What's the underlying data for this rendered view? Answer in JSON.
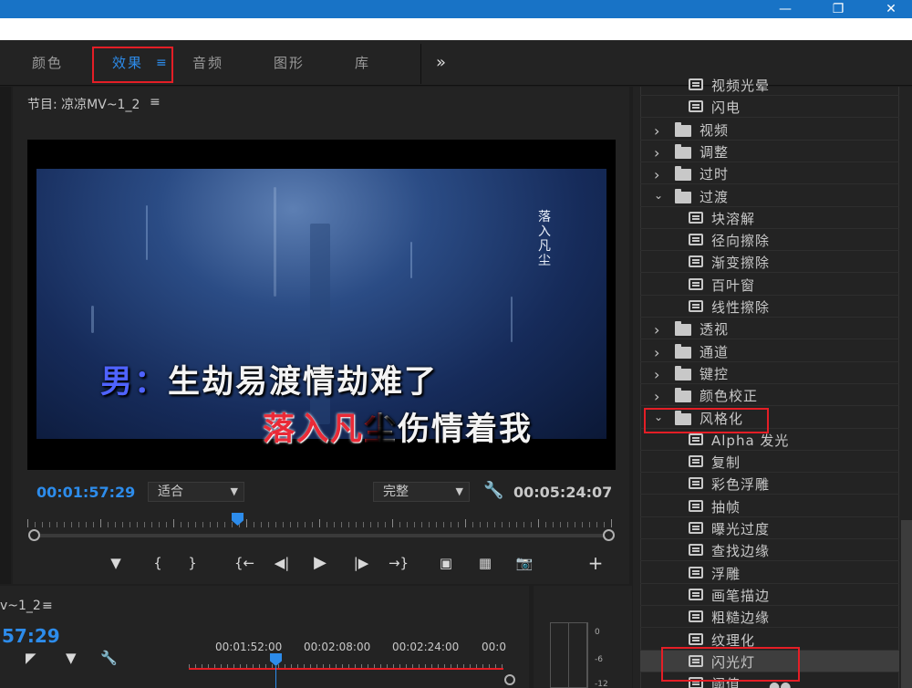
{
  "window": {
    "minimize": "—",
    "restore": "❐",
    "close": "✕"
  },
  "tabs": [
    {
      "label": "颜色"
    },
    {
      "label": "效果",
      "menu": "≡"
    },
    {
      "label": "音频"
    },
    {
      "label": "图形"
    },
    {
      "label": "库"
    }
  ],
  "tabs_overflow": "»",
  "program": {
    "title": "节目: 凉凉MV~1_2",
    "menu": "≡",
    "video": {
      "side_title": "落入凡尘",
      "lyric1_speaker": "男：",
      "lyric1_text": "生劫易渡情劫难了",
      "lyric2_sung": "落入凡",
      "lyric2_partial": "尘",
      "lyric2_rest": "伤情着我"
    },
    "timecode_current": "00:01:57:29",
    "fit_select": "适合",
    "quality_select": "完整",
    "timecode_duration": "00:05:24:07",
    "controls": [
      "marker",
      "mark-in",
      "mark-out",
      "go-to-in",
      "step-back",
      "play",
      "step-forward",
      "go-to-out",
      "lift",
      "extract",
      "export-frame",
      "add"
    ]
  },
  "timeline": {
    "title": "v~1_2",
    "menu": "≡",
    "timecode": "57:29",
    "times": [
      "00:01:52:00",
      "00:02:08:00",
      "00:02:24:00",
      "00:0"
    ]
  },
  "meter": {
    "labels": [
      "0",
      "-6",
      "-12"
    ]
  },
  "effects": [
    {
      "type": "preset",
      "label": "视频光晕",
      "indent": 2
    },
    {
      "type": "preset",
      "label": "闪电",
      "indent": 2
    },
    {
      "type": "folder",
      "label": "视频",
      "state": "collapsed"
    },
    {
      "type": "folder",
      "label": "调整",
      "state": "collapsed"
    },
    {
      "type": "folder",
      "label": "过时",
      "state": "collapsed"
    },
    {
      "type": "folder",
      "label": "过渡",
      "state": "expanded"
    },
    {
      "type": "preset",
      "label": "块溶解"
    },
    {
      "type": "preset",
      "label": "径向擦除"
    },
    {
      "type": "preset",
      "label": "渐变擦除"
    },
    {
      "type": "preset",
      "label": "百叶窗"
    },
    {
      "type": "preset",
      "label": "线性擦除"
    },
    {
      "type": "folder",
      "label": "透视",
      "state": "collapsed"
    },
    {
      "type": "folder",
      "label": "通道",
      "state": "collapsed"
    },
    {
      "type": "folder",
      "label": "键控",
      "state": "collapsed"
    },
    {
      "type": "folder",
      "label": "颜色校正",
      "state": "collapsed"
    },
    {
      "type": "folder",
      "label": "风格化",
      "state": "expanded"
    },
    {
      "type": "preset",
      "label": "Alpha 发光"
    },
    {
      "type": "preset",
      "label": "复制"
    },
    {
      "type": "preset",
      "label": "彩色浮雕"
    },
    {
      "type": "preset",
      "label": "抽帧"
    },
    {
      "type": "preset",
      "label": "曝光过度"
    },
    {
      "type": "preset",
      "label": "查找边缘"
    },
    {
      "type": "preset",
      "label": "浮雕"
    },
    {
      "type": "preset",
      "label": "画笔描边"
    },
    {
      "type": "preset",
      "label": "粗糙边缘"
    },
    {
      "type": "preset",
      "label": "纹理化"
    },
    {
      "type": "preset",
      "label": "闪光灯",
      "selected": true
    },
    {
      "type": "preset",
      "label": "阈值"
    }
  ],
  "highlight_color": "#e41e26",
  "accent_color": "#2d8ceb"
}
